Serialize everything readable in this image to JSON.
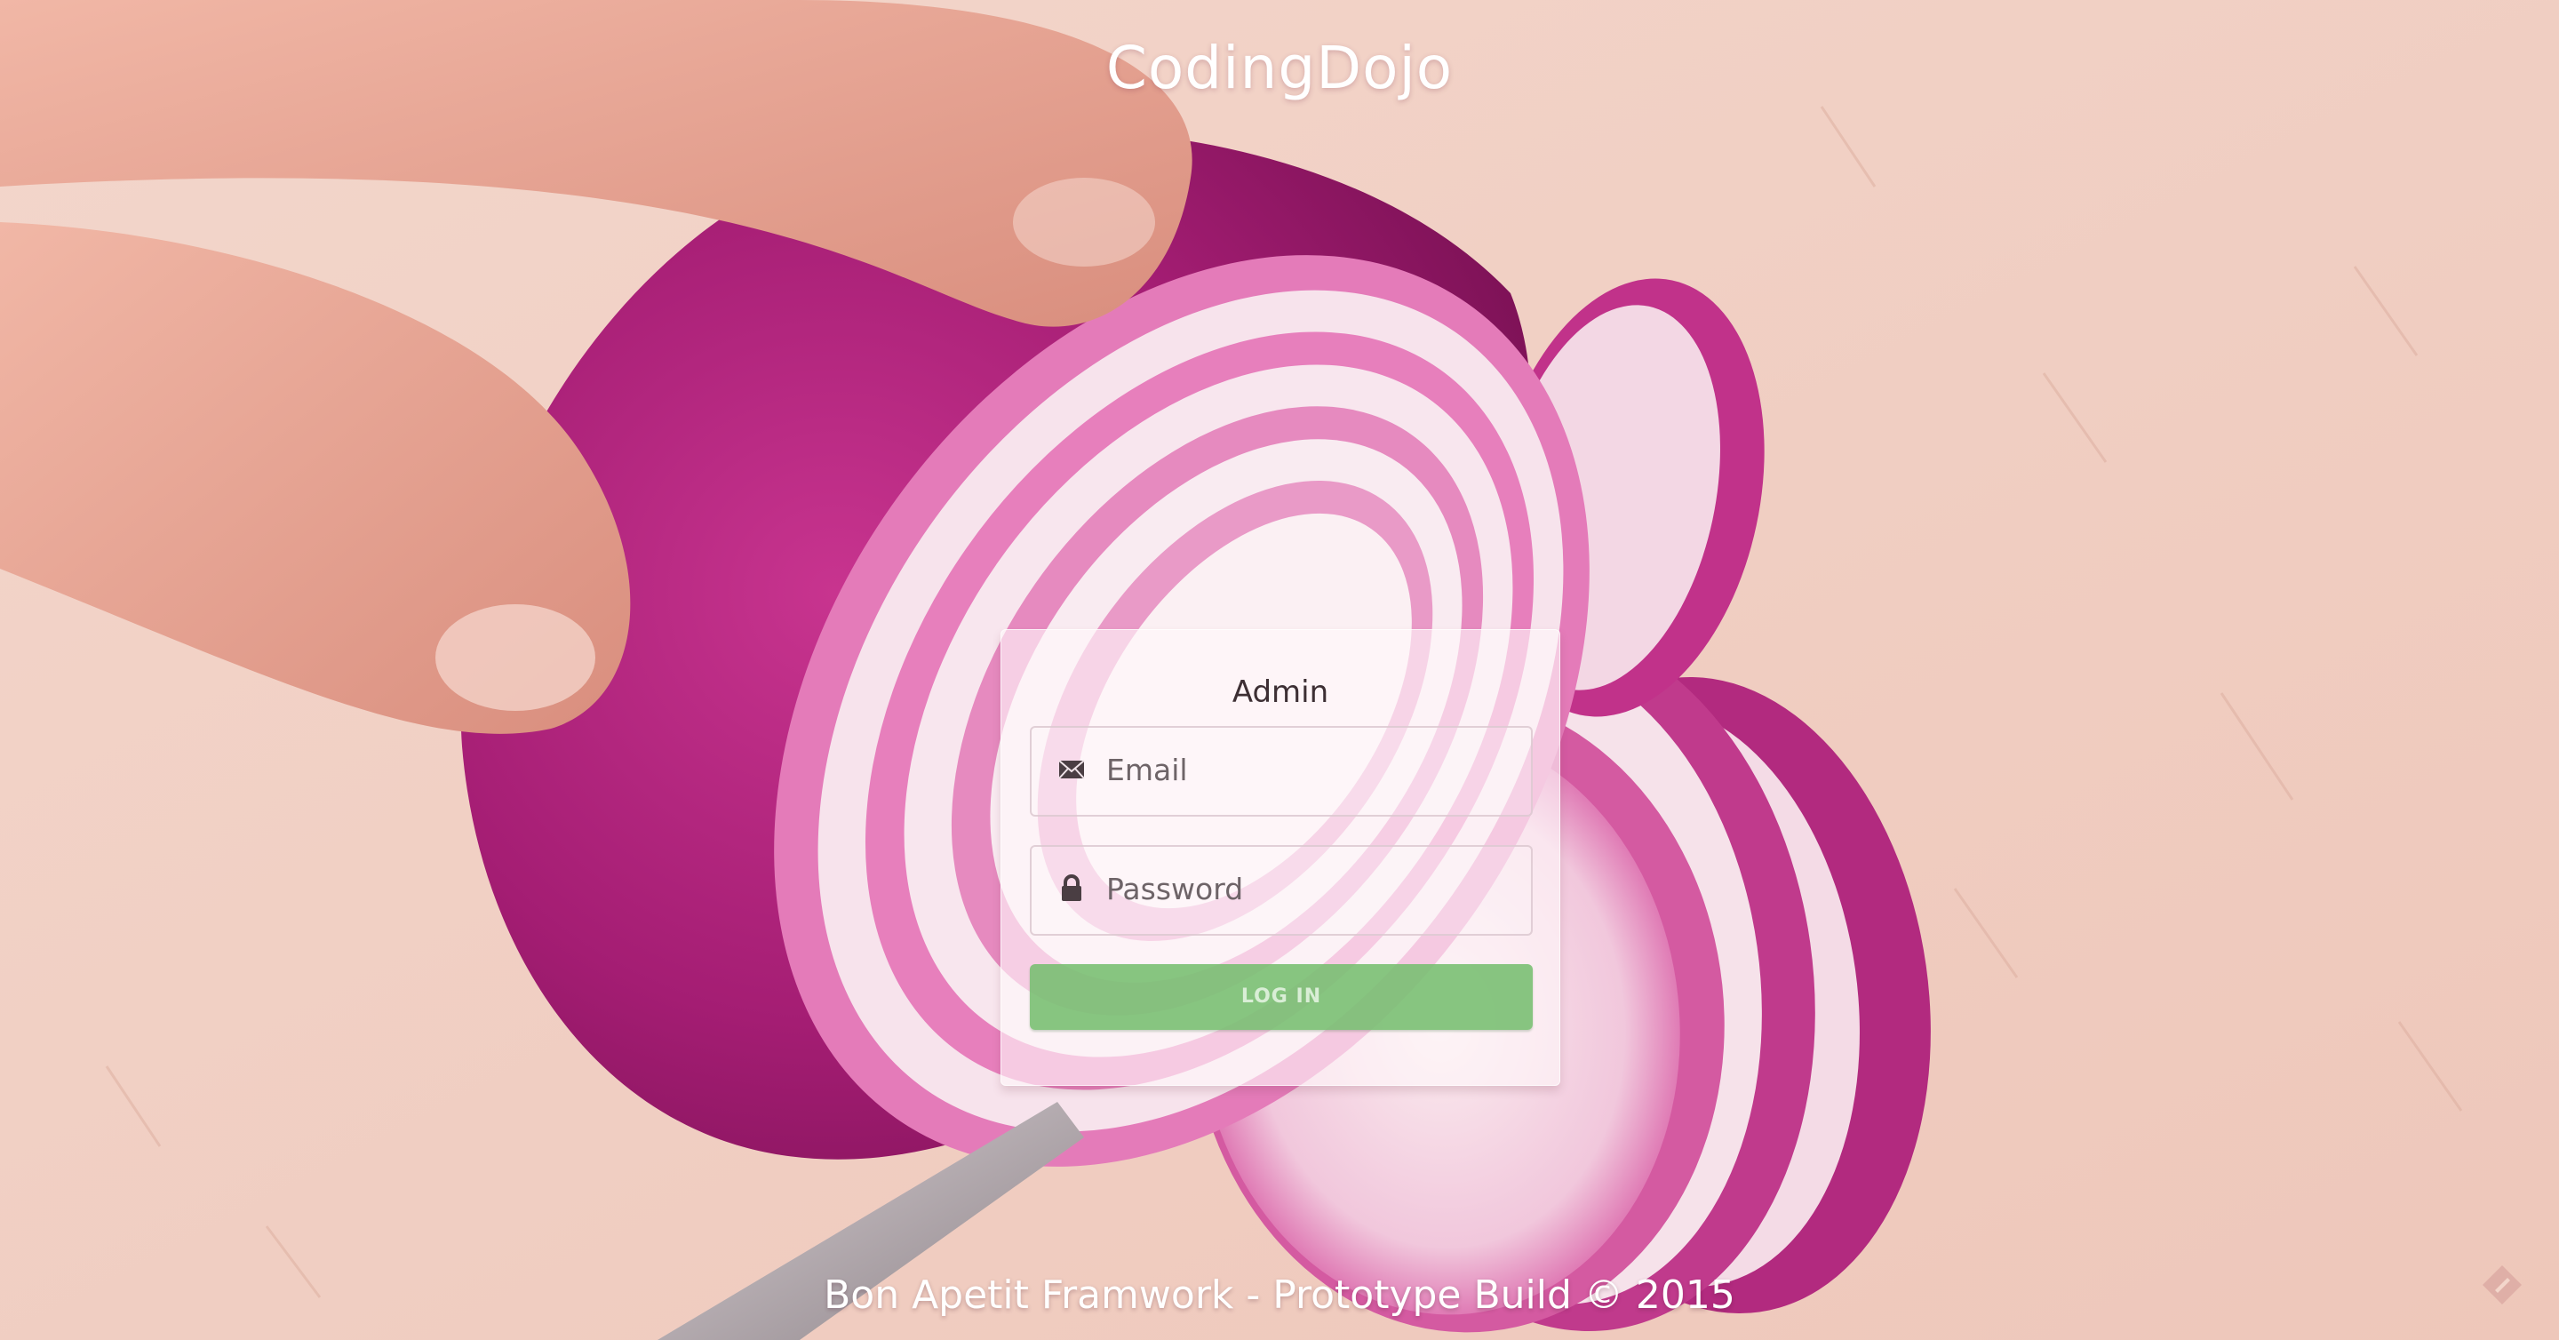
{
  "brand": {
    "title": "CodingDojo"
  },
  "login": {
    "heading": "Admin",
    "email_placeholder": "Email",
    "email_icon": "envelope-icon",
    "password_placeholder": "Password",
    "password_icon": "lock-icon",
    "submit_label": "LOG IN"
  },
  "footer": {
    "text": "Bon Apetit Framwork - Prototype Build © 2015"
  },
  "colors": {
    "button": "#76be70",
    "background": "#f0cfc3",
    "onion": "#b0237a"
  }
}
